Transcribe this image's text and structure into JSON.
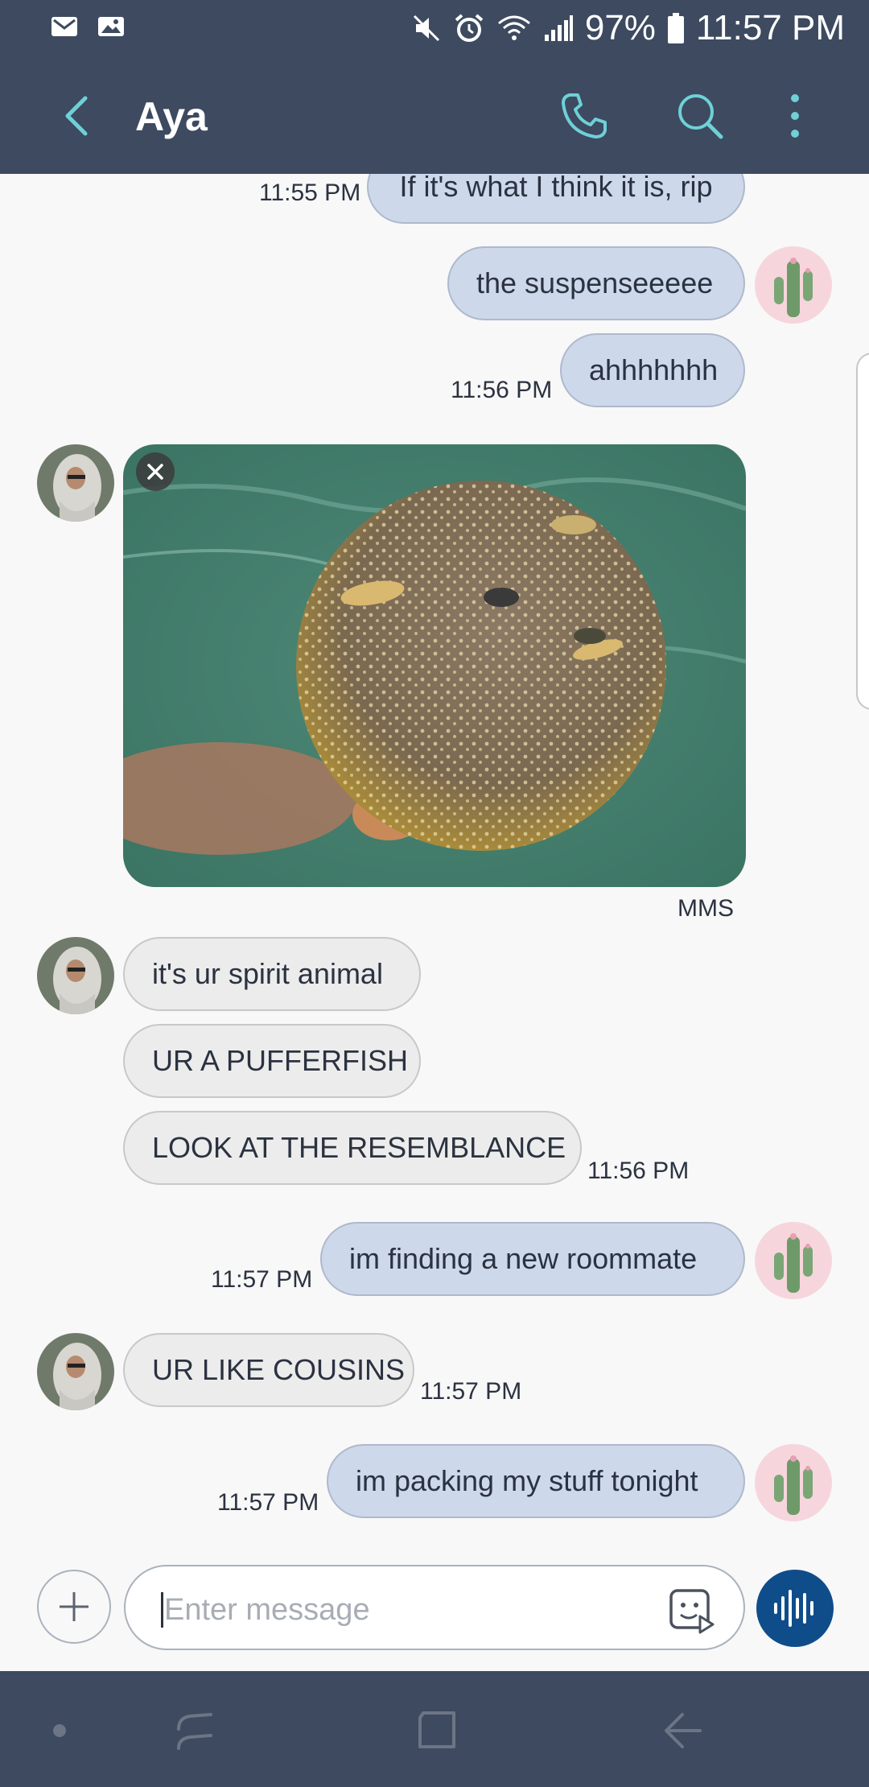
{
  "status_bar": {
    "battery": "97%",
    "time": "11:57 PM",
    "left_icons": [
      "gmail-icon",
      "gallery-icon"
    ],
    "right_icons": [
      "mute-icon",
      "alarm-icon",
      "wifi-icon",
      "signal-icon",
      "battery-icon"
    ]
  },
  "header": {
    "contact_name": "Aya",
    "icons": [
      "back-icon",
      "phone-icon",
      "search-icon",
      "more-icon"
    ]
  },
  "messages": {
    "m1": {
      "text": "If it's what I think it is, rip",
      "time": "11:55 PM"
    },
    "m2": {
      "text": "the suspenseeeee"
    },
    "m3": {
      "text": "ahhhhhhh",
      "time": "11:56 PM"
    },
    "mms_label": "MMS",
    "m4": {
      "text": "it's ur spirit animal"
    },
    "m5": {
      "text": "UR A PUFFERFISH"
    },
    "m6": {
      "text": "LOOK AT THE RESEMBLANCE",
      "time": "11:56 PM"
    },
    "m7": {
      "text": "im finding a new roommate",
      "time": "11:57 PM"
    },
    "m8": {
      "text": "UR LIKE COUSINS",
      "time": "11:57 PM"
    },
    "m9": {
      "text": "im packing my stuff tonight",
      "time": "11:57 PM"
    }
  },
  "composer": {
    "placeholder": "Enter message"
  },
  "colors": {
    "header_bg": "#3d4a5f",
    "accent": "#6fd0d8",
    "outgoing_bubble": "#cdd8eb",
    "incoming_bubble": "#ececec",
    "voice_button": "#0f4d8a"
  }
}
